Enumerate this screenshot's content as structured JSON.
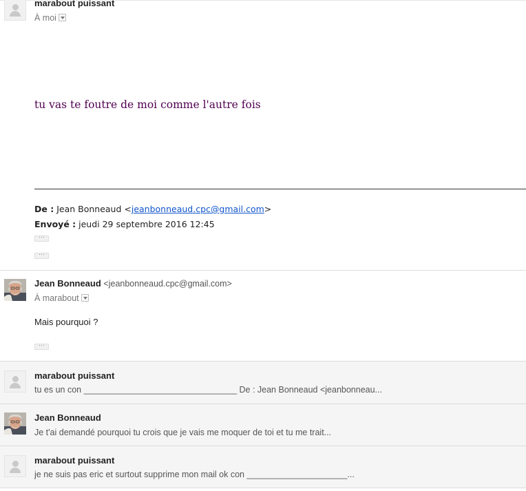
{
  "message1": {
    "sender": "marabout puissant",
    "to": "À moi",
    "body": "tu vas te foutre de moi comme l'autre fois",
    "quoted_header": {
      "from_label": "De :",
      "from_name": "Jean Bonneaud <",
      "from_email": "jeanbonneaud.cpc@gmail.com",
      "from_close": ">",
      "sent_label": "Envoyé :",
      "sent_value": "jeudi 29 septembre 2016 12:45"
    },
    "dots": "···"
  },
  "message2": {
    "sender": "Jean Bonneaud",
    "email": "<jeanbonneaud.cpc@gmail.com>",
    "to": "À marabout",
    "body": "Mais pourquoi ?",
    "dots": "···"
  },
  "collapsed": [
    {
      "sender": "marabout puissant",
      "snippet": "tu es un con ________________________________ De : Jean Bonneaud <jeanbonneau..."
    },
    {
      "sender": "Jean Bonneaud",
      "snippet": "Je t'ai demandé pourquoi tu crois que je vais me moquer de toi et tu me trait..."
    },
    {
      "sender": "marabout puissant",
      "snippet": "je ne suis pas eric et surtout supprime mon mail ok con _____________________..."
    }
  ],
  "colors": {
    "serif_body": "#500050",
    "link": "#1155cc",
    "collapsed_bg": "#f5f5f5"
  }
}
